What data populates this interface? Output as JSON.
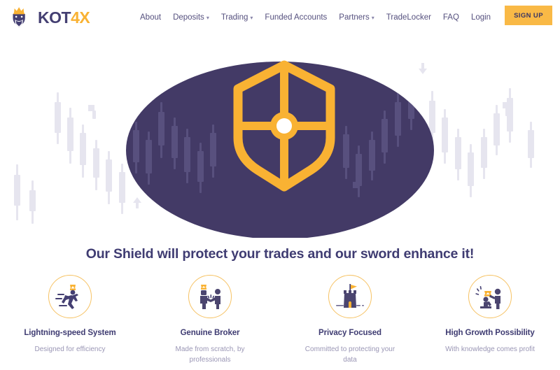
{
  "header": {
    "logo": {
      "icon": "king-head-icon",
      "text_primary": "KOT",
      "text_accent": "4X"
    },
    "nav_items": [
      {
        "label": "About",
        "has_dropdown": false
      },
      {
        "label": "Deposits",
        "has_dropdown": true
      },
      {
        "label": "Trading",
        "has_dropdown": true
      },
      {
        "label": "Funded Accounts",
        "has_dropdown": false
      },
      {
        "label": "Partners",
        "has_dropdown": true
      },
      {
        "label": "TradeLocker",
        "has_dropdown": false
      },
      {
        "label": "FAQ",
        "has_dropdown": false
      },
      {
        "label": "Login",
        "has_dropdown": false
      }
    ],
    "signup_label": "SIGN UP"
  },
  "hero": {
    "shield_icon": "shield-with-cross-icon",
    "background_shape": "ellipse",
    "chart_motif": "candlestick-chart"
  },
  "headline": "Our Shield will protect your trades and our sword enhance it!",
  "features": [
    {
      "icon": "running-king-icon",
      "title": "Lightning-speed System",
      "description": "Designed for efficiency"
    },
    {
      "icon": "handshake-king-icon",
      "title": "Genuine Broker",
      "description": "Made from scratch, by professionals"
    },
    {
      "icon": "castle-tower-flag-icon",
      "title": "Privacy Focused",
      "description": "Committed to protecting your data"
    },
    {
      "icon": "coronation-icon",
      "title": "High Growth Possibility",
      "description": "With knowledge comes profit"
    }
  ],
  "colors": {
    "accent_orange": "#f9b233",
    "brand_purple": "#443f72",
    "hero_ellipse": "#433a66",
    "heading_text": "#3f3c72",
    "body_text": "#9a96b5",
    "nav_text": "#55507e",
    "candle_outer": "#e4e3ee",
    "candle_inner": "#5b5383",
    "page_background": "#ffffff"
  }
}
